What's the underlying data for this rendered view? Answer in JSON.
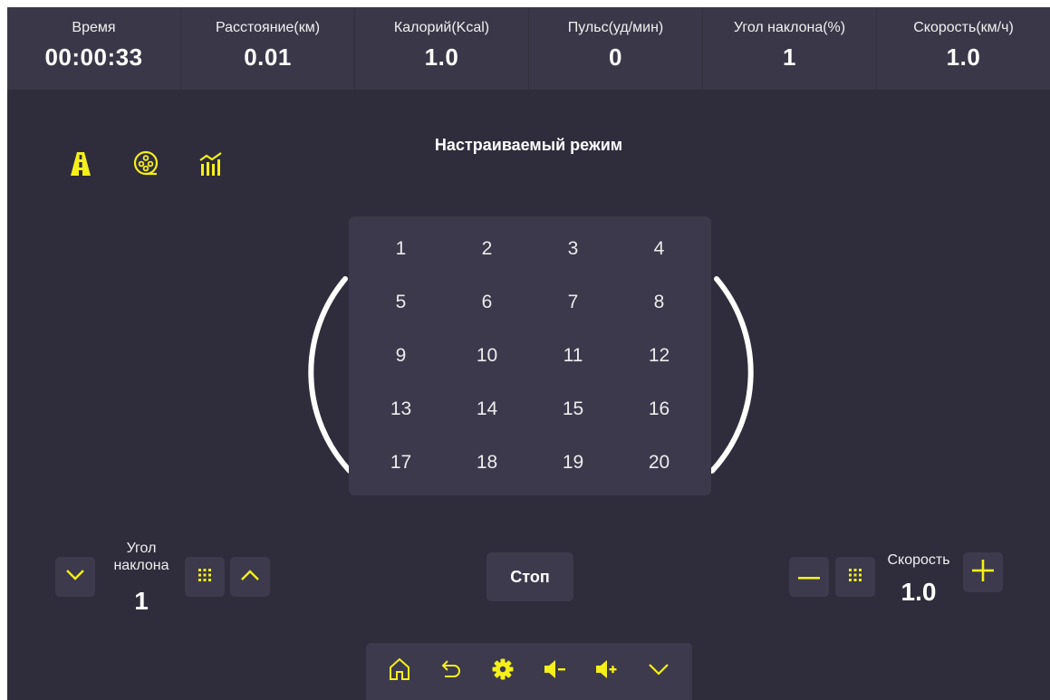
{
  "accent_color": "#f5ef1a",
  "stats": [
    {
      "label": "Время",
      "value": "00:00:33"
    },
    {
      "label": "Расстояние(км)",
      "value": "0.01"
    },
    {
      "label": "Калорий(Kcal)",
      "value": "1.0"
    },
    {
      "label": "Пульс(уд/мин)",
      "value": "0"
    },
    {
      "label": "Угол наклона(%)",
      "value": "1"
    },
    {
      "label": "Скорость(км/ч)",
      "value": "1.0"
    }
  ],
  "mode_icons": [
    "road-icon",
    "film-reel-icon",
    "chart-bars-icon"
  ],
  "mode_title": "Настраиваемый режим",
  "programs": [
    "1",
    "2",
    "3",
    "4",
    "5",
    "6",
    "7",
    "8",
    "9",
    "10",
    "11",
    "12",
    "13",
    "14",
    "15",
    "16",
    "17",
    "18",
    "19",
    "20"
  ],
  "incline": {
    "label_line1": "Угол",
    "label_line2": "наклона",
    "value": "1"
  },
  "speed": {
    "label": "Скорость",
    "value": "1.0"
  },
  "stop_label": "Стоп",
  "bottom_nav": [
    "home-icon",
    "back-icon",
    "settings-icon",
    "volume-down-icon",
    "volume-up-icon",
    "collapse-icon"
  ]
}
